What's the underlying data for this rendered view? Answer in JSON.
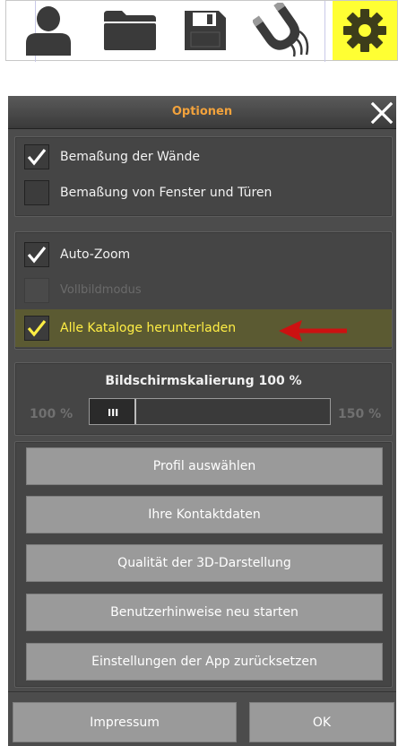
{
  "toolbar": {
    "buttons": [
      {
        "name": "user",
        "icon": "person-icon"
      },
      {
        "name": "open",
        "icon": "folder-icon"
      },
      {
        "name": "save",
        "icon": "floppy-disk-icon"
      },
      {
        "name": "magnet",
        "icon": "magnet-icon"
      },
      {
        "name": "settings",
        "icon": "gear-icon",
        "active": true
      }
    ],
    "active_color": "#ffff33"
  },
  "dialog": {
    "title": "Optionen",
    "title_color": "#f2a23c",
    "close_icon": "close-icon",
    "group1": [
      {
        "label": "Bemaßung der Wände",
        "checked": true
      },
      {
        "label": "Bemaßung von Fenster und Türen",
        "checked": false
      }
    ],
    "group2": [
      {
        "label": "Auto-Zoom",
        "checked": true,
        "enabled": true
      },
      {
        "label": "Vollbildmodus",
        "checked": false,
        "enabled": false
      },
      {
        "label": "Alle Kataloge herunterladen",
        "checked": true,
        "enabled": true,
        "highlighted": true
      }
    ],
    "highlight_color": "#ffee44",
    "scaling": {
      "title": "Bildschirmskalierung  100 %",
      "min_label": "100 %",
      "max_label": "150 %",
      "thumb_label": "III",
      "value_percent": 100,
      "range": [
        100,
        150
      ]
    },
    "buttons": [
      "Profil auswählen",
      "Ihre Kontaktdaten",
      "Qualität der 3D-Darstellung",
      "Benutzerhinweise neu starten",
      "Einstellungen der App zurücksetzen"
    ],
    "footer": {
      "impressum": "Impressum",
      "ok": "OK"
    },
    "annotation_arrow_color": "#cc1111"
  }
}
